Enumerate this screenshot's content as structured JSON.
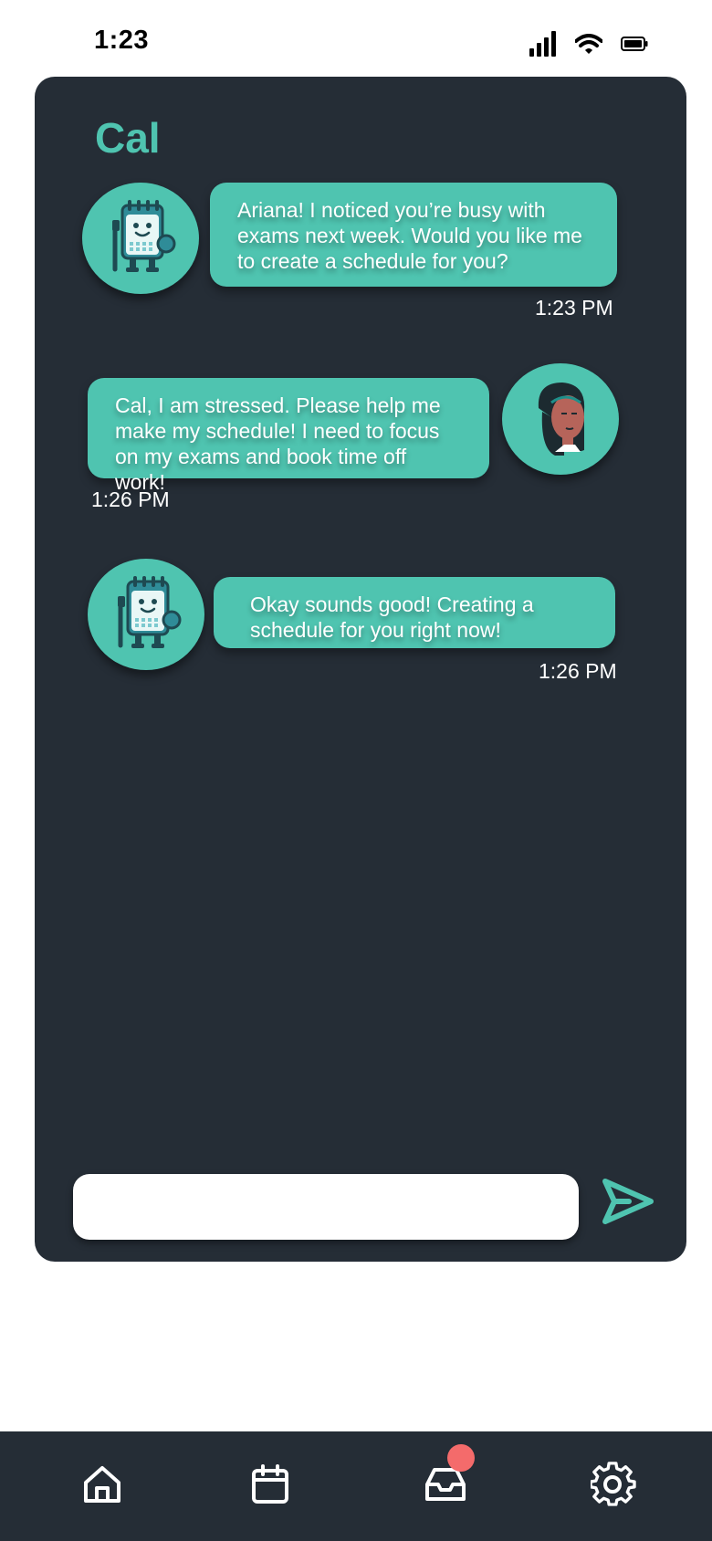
{
  "status_bar": {
    "time": "1:23"
  },
  "chat": {
    "title": "Cal",
    "messages": [
      {
        "sender": "Cal",
        "avatar_icon": "calendar-robot-icon",
        "text": "Ariana! I noticed you’re busy with exams next week. Would you like me to create a schedule for you?",
        "time": "1:23 PM"
      },
      {
        "sender": "Ariana",
        "avatar_icon": "user-woman-icon",
        "text": "Cal, I am stressed. Please help me make my schedule! I need to focus on my exams and book time off work!",
        "time": "1:26 PM"
      },
      {
        "sender": "Cal",
        "avatar_icon": "calendar-robot-icon",
        "text": "Okay sounds good! Creating a schedule for you right now!",
        "time": "1:26 PM"
      }
    ],
    "input": {
      "value": "",
      "placeholder": ""
    },
    "send_icon": "send-icon"
  },
  "bottom_nav": {
    "items": [
      {
        "icon": "home-icon"
      },
      {
        "icon": "calendar-icon"
      },
      {
        "icon": "inbox-icon",
        "badge": true
      },
      {
        "icon": "gear-icon"
      }
    ]
  },
  "colors": {
    "accent": "#4fc4b0",
    "panel": "#252d36",
    "badge": "#f46b6b",
    "background": "#ffffff"
  }
}
